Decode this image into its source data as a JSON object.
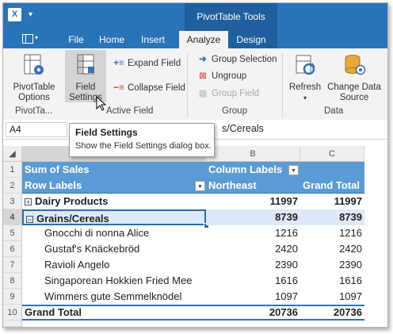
{
  "title_bar": {
    "contextual_group": "PivotTable Tools"
  },
  "tabs": [
    "File",
    "Home",
    "Insert",
    "Analyze",
    "Design"
  ],
  "active_tab": "Analyze",
  "ribbon": {
    "pivottable_options": "PivotTable\nOptions",
    "field_settings": "Field\nSettings",
    "expand_field": "Expand Field",
    "collapse_field": "Collapse Field",
    "group_selection": "Group Selection",
    "ungroup": "Ungroup",
    "group_field": "Group Field",
    "refresh": "Refresh",
    "change_data_source": "Change Data\nSource",
    "groups": {
      "pivottable": "PivotTa...",
      "active_field": "Active Field",
      "group": "Group",
      "data": "Data"
    }
  },
  "formula_bar": {
    "name_box": "A4",
    "content": "s/Cereals"
  },
  "tooltip": {
    "title": "Field Settings",
    "text": "Show the Field Settings dialog box."
  },
  "columns": [
    "B",
    "C"
  ],
  "rows": [
    {
      "num": "1",
      "a": "Sum of Sales",
      "b": "Column Labels",
      "c": ""
    },
    {
      "num": "2",
      "a": "Row Labels",
      "b": "Northeast",
      "c": "Grand Total"
    },
    {
      "num": "3",
      "a": "Dairy Products",
      "b": "11997",
      "c": "11997"
    },
    {
      "num": "4",
      "a": "Grains/Cereals",
      "b": "8739",
      "c": "8739"
    },
    {
      "num": "5",
      "a": "Gnocchi di nonna Alice",
      "b": "1216",
      "c": "1216"
    },
    {
      "num": "6",
      "a": "Gustaf's Knäckebröd",
      "b": "2420",
      "c": "2420"
    },
    {
      "num": "7",
      "a": "Ravioli Angelo",
      "b": "2390",
      "c": "2390"
    },
    {
      "num": "8",
      "a": "Singaporean Hokkien Fried Mee",
      "b": "1616",
      "c": "1616"
    },
    {
      "num": "9",
      "a": "Wimmers gute Semmelknödel",
      "b": "1097",
      "c": "1097"
    },
    {
      "num": "10",
      "a": "Grand Total",
      "b": "20736",
      "c": "20736"
    }
  ],
  "colors": {
    "accent": "#2b73b8",
    "pivot_header": "#5b9bd5",
    "selection": "#217346"
  },
  "icons": {
    "pivottable_options": "gear-icon",
    "field_settings": "field-settings-icon",
    "expand": "plus-icon",
    "collapse": "minus-icon",
    "group_selection": "arrow-right-icon",
    "ungroup": "ungroup-icon",
    "refresh": "refresh-icon",
    "change_data_source": "database-icon"
  }
}
